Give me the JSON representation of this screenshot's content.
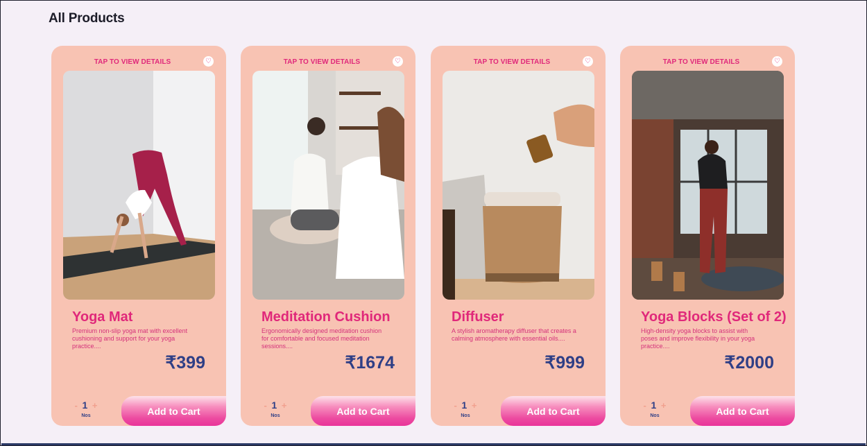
{
  "page": {
    "title": "All Products"
  },
  "products": [
    {
      "tap_label": "TAP TO VIEW DETAILS",
      "name": "Yoga Mat",
      "description": "Premium non-slip yoga mat with excellent cushioning and support for your yoga practice....",
      "price": "₹399",
      "qty": {
        "minus": "-",
        "value": "1",
        "plus": "+",
        "unit": "Nos"
      },
      "add_to_cart": "Add to Cart"
    },
    {
      "tap_label": "TAP TO VIEW DETAILS",
      "name": "Meditation Cushion",
      "description": "Ergonomically designed meditation cushion for comfortable and focused meditation sessions....",
      "price": "₹1674",
      "qty": {
        "minus": "-",
        "value": "1",
        "plus": "+",
        "unit": "Nos"
      },
      "add_to_cart": "Add to Cart"
    },
    {
      "tap_label": "TAP TO VIEW DETAILS",
      "name": "Diffuser",
      "description": "A stylish aromatherapy diffuser that creates a calming atmosphere with essential oils....",
      "price": "₹999",
      "qty": {
        "minus": "-",
        "value": "1",
        "plus": "+",
        "unit": "Nos"
      },
      "add_to_cart": "Add to Cart"
    },
    {
      "tap_label": "TAP TO VIEW DETAILS",
      "name": "Yoga Blocks (Set of 2)",
      "description": "High-density yoga blocks to assist with poses and improve flexibility in your yoga practice....",
      "price": "₹2000",
      "qty": {
        "minus": "-",
        "value": "1",
        "plus": "+",
        "unit": "Nos"
      },
      "add_to_cart": "Add to Cart"
    }
  ],
  "icons": {
    "wishlist": "heart-icon"
  },
  "colors": {
    "card_bg": "#f8c3b3",
    "accent_pink": "#e0287a",
    "price_navy": "#2f3f86",
    "page_bg": "#f5eff7"
  }
}
